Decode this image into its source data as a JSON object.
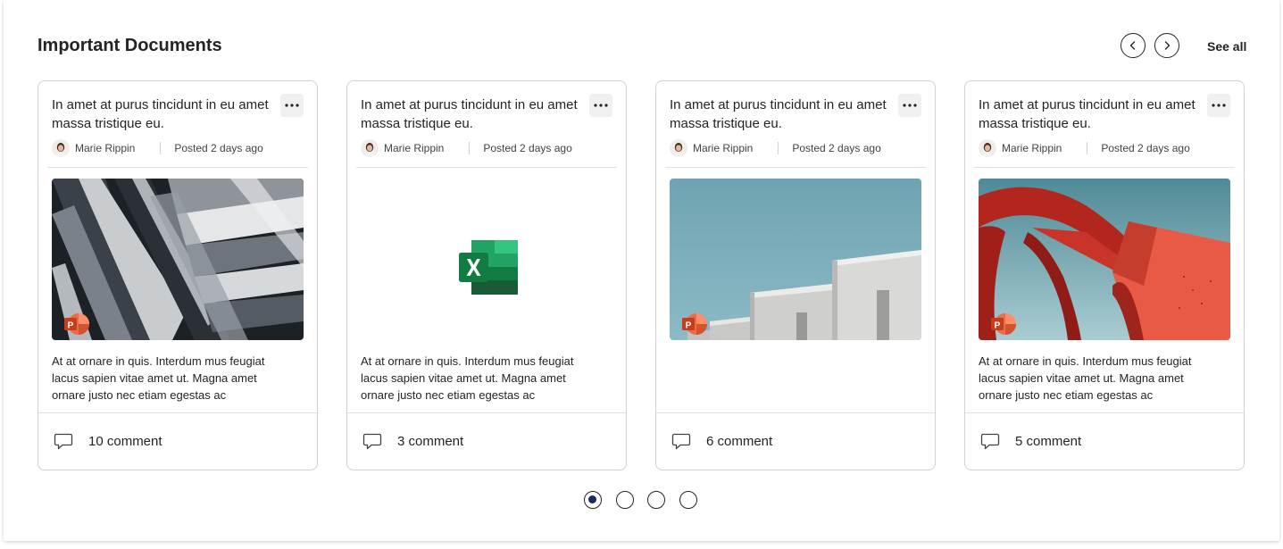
{
  "section": {
    "title": "Important Documents",
    "see_all_label": "See all"
  },
  "cards": [
    {
      "title": "In amet at purus tincidunt in eu amet massa tristique eu.",
      "author": "Marie Rippin",
      "posted": "Posted 2 days ago",
      "thumbnail": "abstract-architecture-photo",
      "file_type_icon": "powerpoint-icon",
      "description": "At at ornare in quis. Interdum mus feugiat lacus sapien vitae amet ut. Magna amet ornare justo nec etiam egestas ac",
      "comments": "10 comment"
    },
    {
      "title": "In amet at purus tincidunt in eu amet massa tristique eu.",
      "author": "Marie Rippin",
      "posted": "Posted 2 days ago",
      "thumbnail": "excel-file",
      "file_type_icon": "excel-icon",
      "description": "At at ornare in quis. Interdum mus feugiat lacus sapien vitae amet ut. Magna amet ornare justo nec etiam egestas ac",
      "comments": "3 comment"
    },
    {
      "title": "In amet at purus tincidunt in eu amet massa tristique eu.",
      "author": "Marie Rippin",
      "posted": "Posted 2 days ago",
      "thumbnail": "white-building-blue-sky-photo",
      "file_type_icon": "powerpoint-icon",
      "description": "",
      "comments": "6 comment"
    },
    {
      "title": "In amet at purus tincidunt in eu amet massa tristique eu.",
      "author": "Marie Rippin",
      "posted": "Posted 2 days ago",
      "thumbnail": "red-sculpture-photo",
      "file_type_icon": "powerpoint-icon",
      "description": "At at ornare in quis. Interdum mus feugiat lacus sapien vitae amet ut. Magna amet ornare justo nec etiam egestas ac",
      "comments": "5 comment"
    }
  ],
  "pagination": {
    "page_count": 4,
    "active_page": 1
  },
  "colors": {
    "text": "#242424",
    "border": "#d1d1d1",
    "active_dot": "#1f2a5c",
    "excel_green": "#107c41",
    "powerpoint_orange": "#c43e1c"
  }
}
